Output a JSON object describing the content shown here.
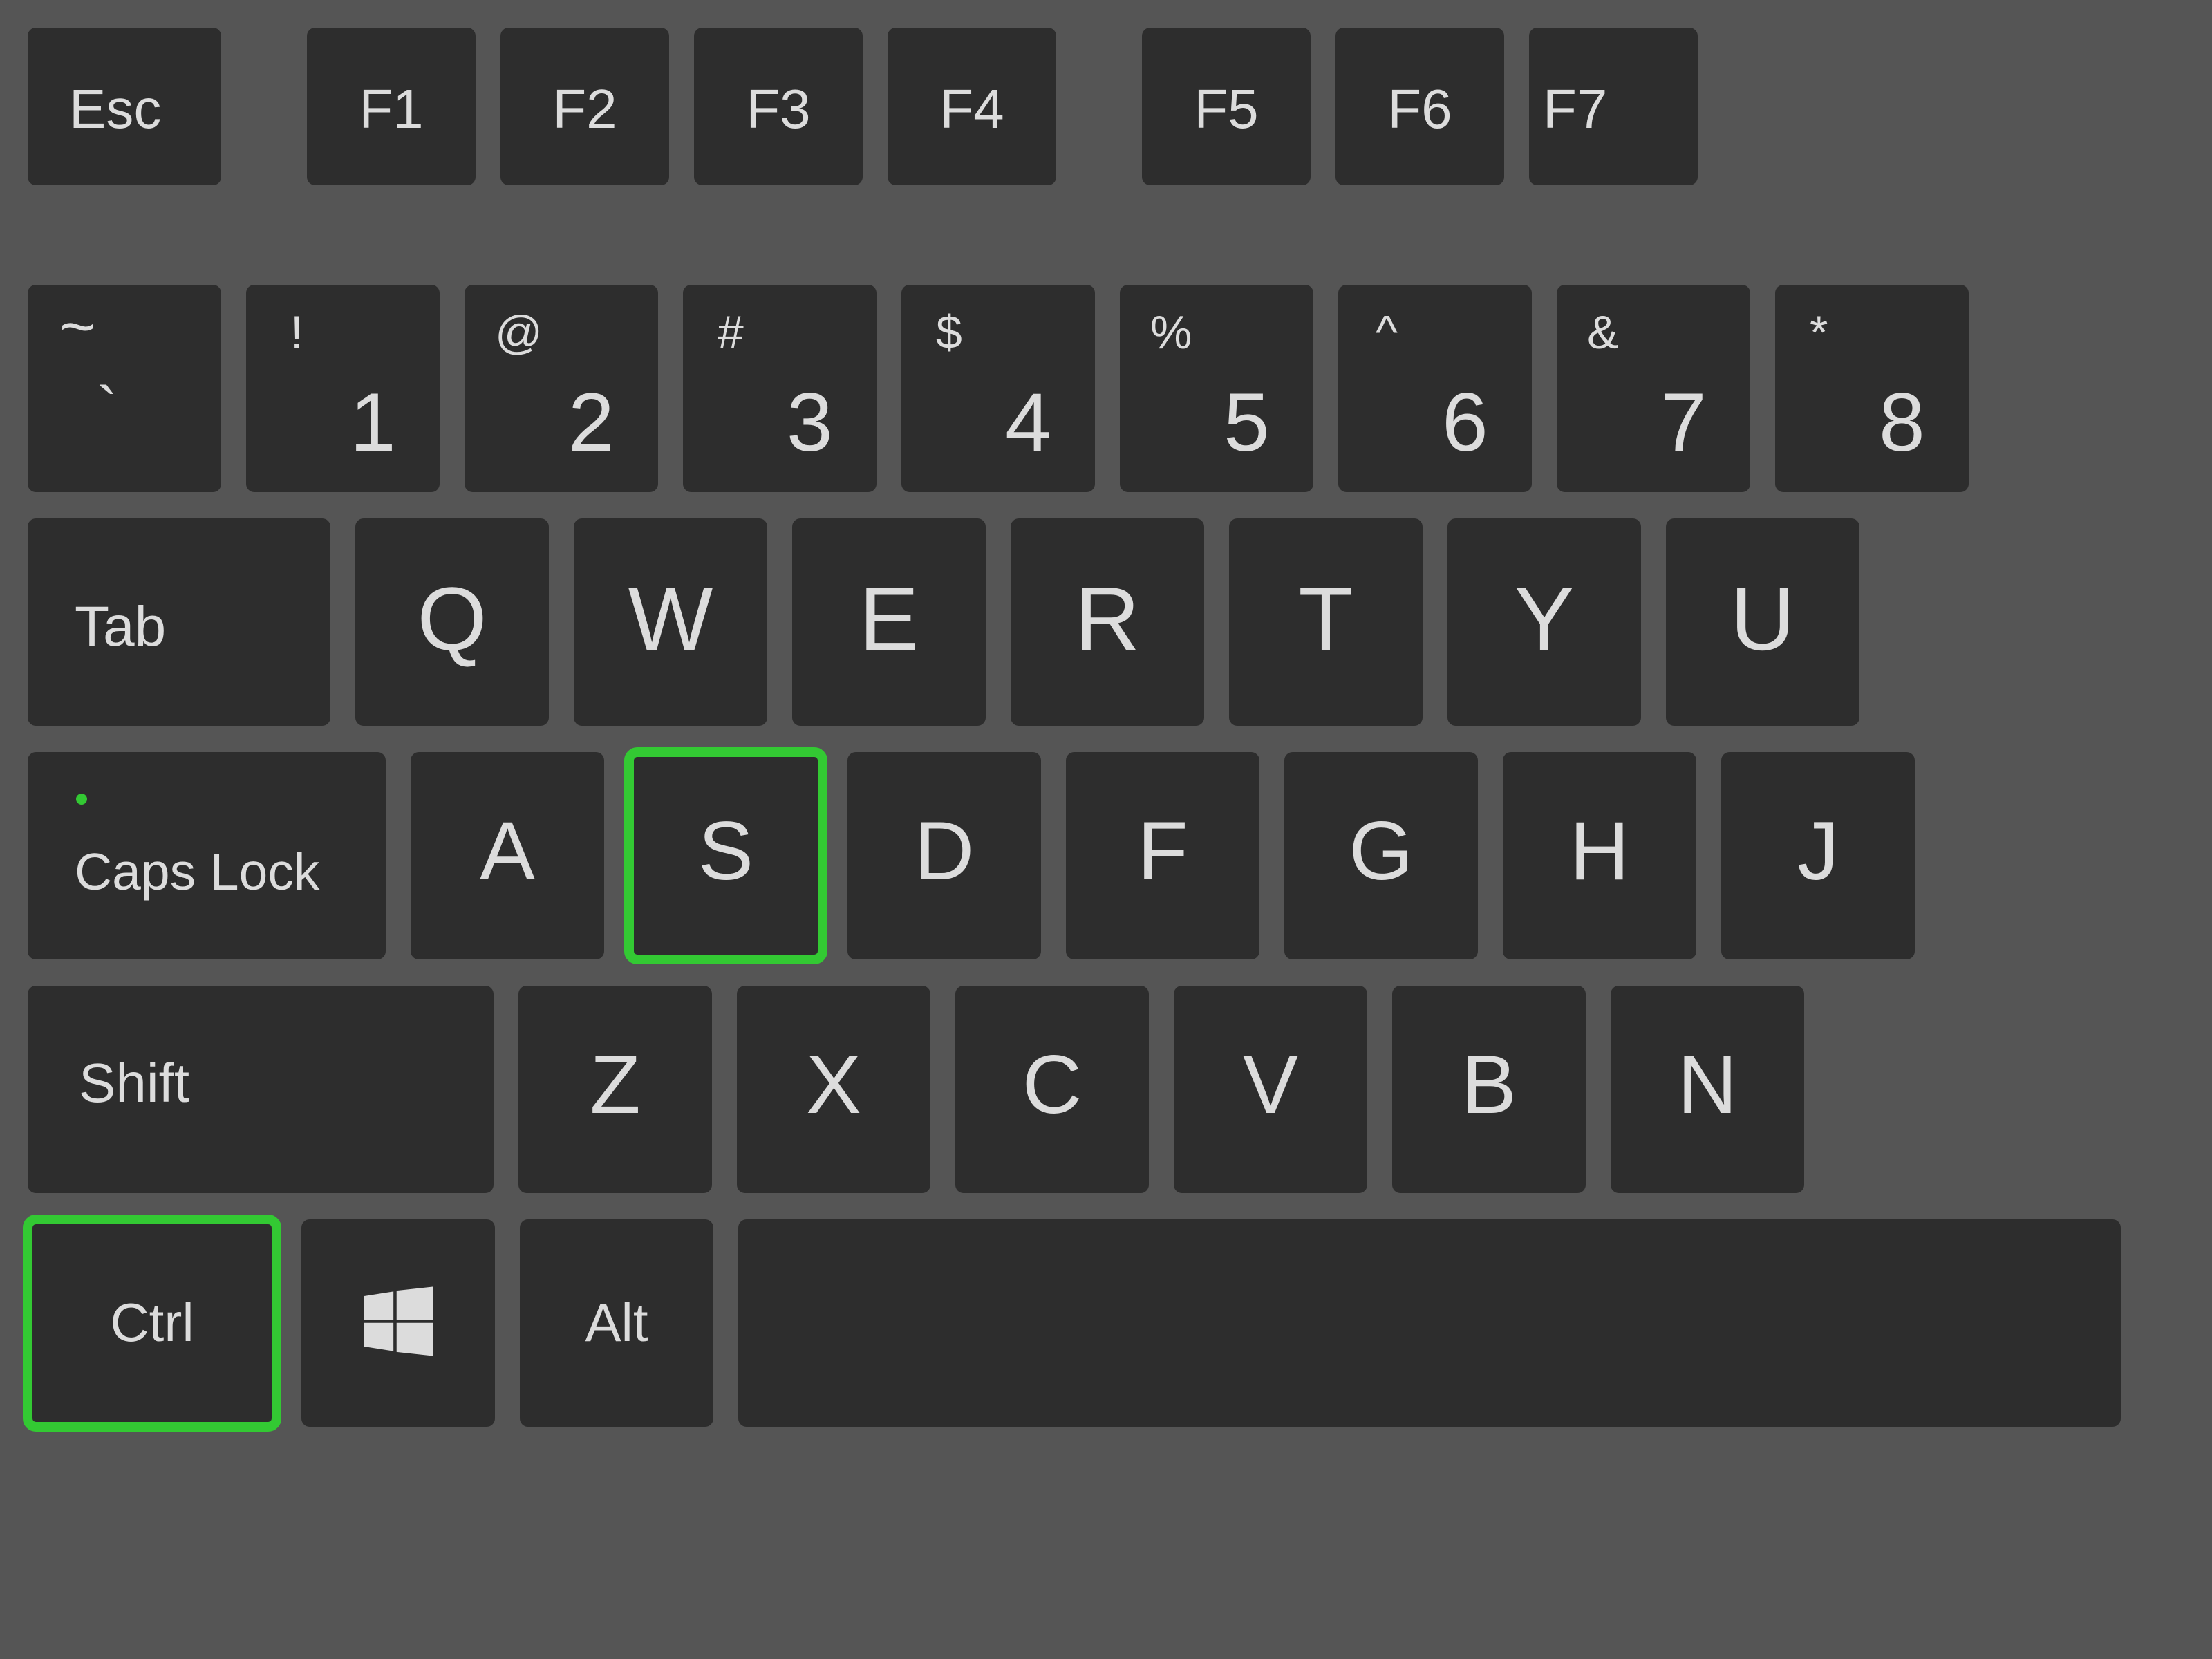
{
  "keyboard": {
    "highlight_color": "#33c933",
    "row_func": {
      "esc": "Esc",
      "f1": "F1",
      "f2": "F2",
      "f3": "F3",
      "f4": "F4",
      "f5": "F5",
      "f6": "F6",
      "f7_partial": "F7"
    },
    "row_num": {
      "tilde_upper": "~",
      "tilde_lower": "`",
      "k1_upper": "!",
      "k1_lower": "1",
      "k2_upper": "@",
      "k2_lower": "2",
      "k3_upper": "#",
      "k3_lower": "3",
      "k4_upper": "$",
      "k4_lower": "4",
      "k5_upper": "%",
      "k5_lower": "5",
      "k6_upper": "^",
      "k6_lower": "6",
      "k7_upper": "&",
      "k7_lower": "7",
      "k8_upper": "*",
      "k8_lower": "8"
    },
    "row_qwerty": {
      "tab": "Tab",
      "q": "Q",
      "w": "W",
      "e": "E",
      "r": "R",
      "t": "T",
      "y": "Y",
      "u": "U"
    },
    "row_home": {
      "caps": "Caps Lock",
      "a": "A",
      "s": "S",
      "d": "D",
      "f": "F",
      "g": "G",
      "h": "H",
      "j": "J"
    },
    "row_shift": {
      "shift": "Shift",
      "z": "Z",
      "x": "X",
      "c": "C",
      "v": "V",
      "b": "B",
      "n": "N"
    },
    "row_bottom": {
      "ctrl": "Ctrl",
      "alt": "Alt"
    },
    "highlighted_keys": [
      "ctrl",
      "s"
    ]
  }
}
